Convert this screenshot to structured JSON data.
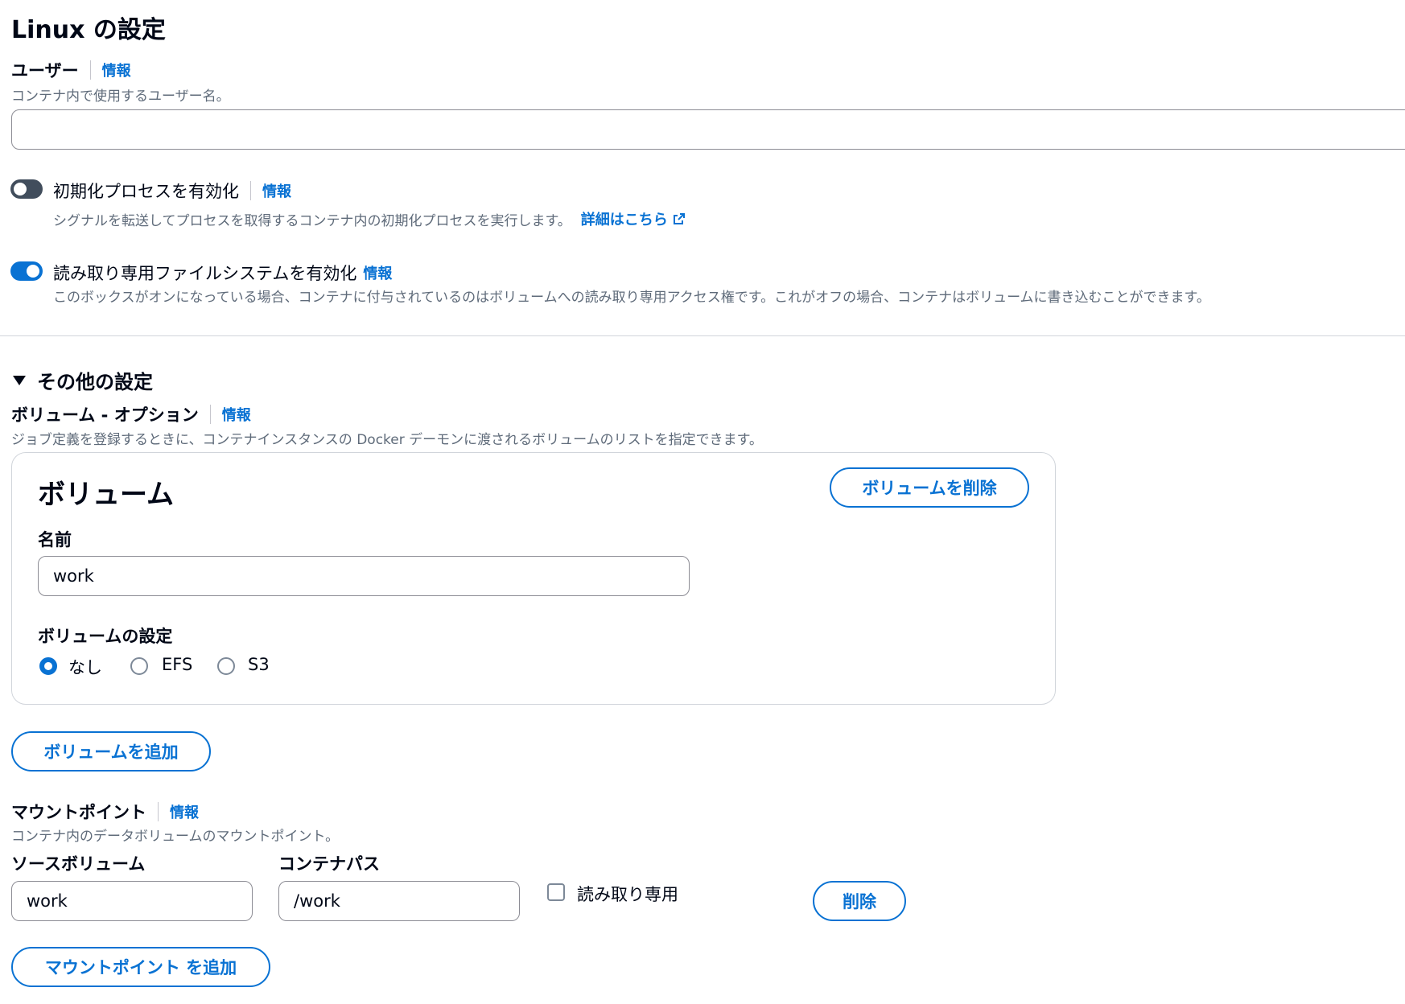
{
  "page": {
    "title": "Linux の設定"
  },
  "user_field": {
    "label": "ユーザー",
    "info": "情報",
    "description": "コンテナ内で使用するユーザー名。",
    "value": "",
    "placeholder": ""
  },
  "init_process": {
    "label": "初期化プロセスを有効化",
    "info": "情報",
    "enabled": false,
    "description": "シグナルを転送してプロセスを取得するコンテナ内の初期化プロセスを実行します。",
    "link": "詳細はこちら"
  },
  "readonly_fs": {
    "label": "読み取り専用ファイルシステムを有効化",
    "info": "情報",
    "enabled": true,
    "description": "このボックスがオンになっている場合、コンテナに付与されているのはボリュームへの読み取り専用アクセス権です。これがオフの場合、コンテナはボリュームに書き込むことができます。"
  },
  "other_settings": {
    "title": "その他の設定",
    "expanded": true
  },
  "volumes": {
    "label": "ボリューム - オプション",
    "info": "情報",
    "description": "ジョブ定義を登録するときに、コンテナインスタンスの Docker デーモンに渡されるボリュームのリストを指定できます。",
    "card": {
      "title": "ボリューム",
      "remove_button": "ボリュームを削除",
      "name_label": "名前",
      "name_value": "work",
      "config_label": "ボリュームの設定",
      "options": [
        "なし",
        "EFS",
        "S3"
      ],
      "selected": "なし"
    },
    "add_button": "ボリュームを追加"
  },
  "mount_points": {
    "label": "マウントポイント",
    "info": "情報",
    "description": "コンテナ内のデータボリュームのマウントポイント。",
    "source_label": "ソースボリューム",
    "source_value": "work",
    "path_label": "コンテナパス",
    "path_value": "/work",
    "readonly_label": "読み取り専用",
    "readonly_checked": false,
    "remove_button": "削除",
    "add_button": "マウントポイント を追加"
  },
  "colors": {
    "accent": "#0972d3",
    "text": "#000716",
    "muted": "#5f6b7a"
  }
}
